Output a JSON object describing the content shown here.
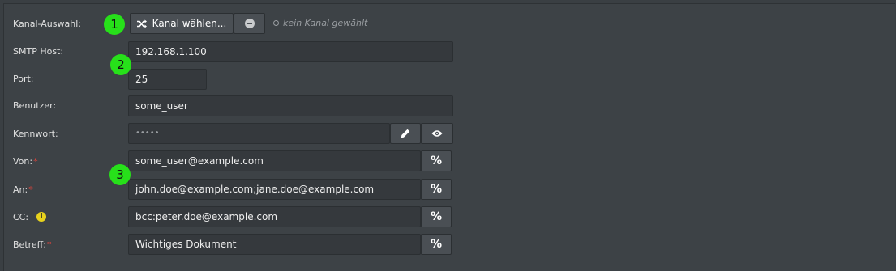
{
  "channel": {
    "label": "Kanal-Auswahl:",
    "choose_button": "Kanal wählen...",
    "status": "kein Kanal gewählt"
  },
  "fields": {
    "smtp_host": {
      "label": "SMTP Host:",
      "value": "192.168.1.100"
    },
    "port": {
      "label": "Port:",
      "value": "25"
    },
    "user": {
      "label": "Benutzer:",
      "value": "some_user"
    },
    "password": {
      "label": "Kennwort:",
      "value": "•••••"
    },
    "from": {
      "label": "Von:",
      "required": "*",
      "value": "some_user@example.com"
    },
    "to": {
      "label": "An:",
      "required": "*",
      "value": "john.doe@example.com;jane.doe@example.com"
    },
    "cc": {
      "label": "CC:",
      "value": "bcc:peter.doe@example.com",
      "info": "i"
    },
    "subject": {
      "label": "Betreff:",
      "required": "*",
      "value": "Wichtiges Dokument"
    }
  },
  "markers": [
    "1",
    "2",
    "3"
  ],
  "colors": {
    "background": "#3d4246",
    "input_bg": "#35393d",
    "button_bg": "#4a4f54",
    "marker": "#27e01a",
    "required": "#e2453c",
    "info": "#e8d21d"
  },
  "icons": {
    "channel_button": "shuffle-icon",
    "clear_button": "minus-circle-icon",
    "status_indicator": "circle-outline-icon",
    "edit_button": "pencil-icon",
    "show_button": "eye-icon",
    "placeholder_button": "percent-icon",
    "cc_info": "info-icon"
  }
}
